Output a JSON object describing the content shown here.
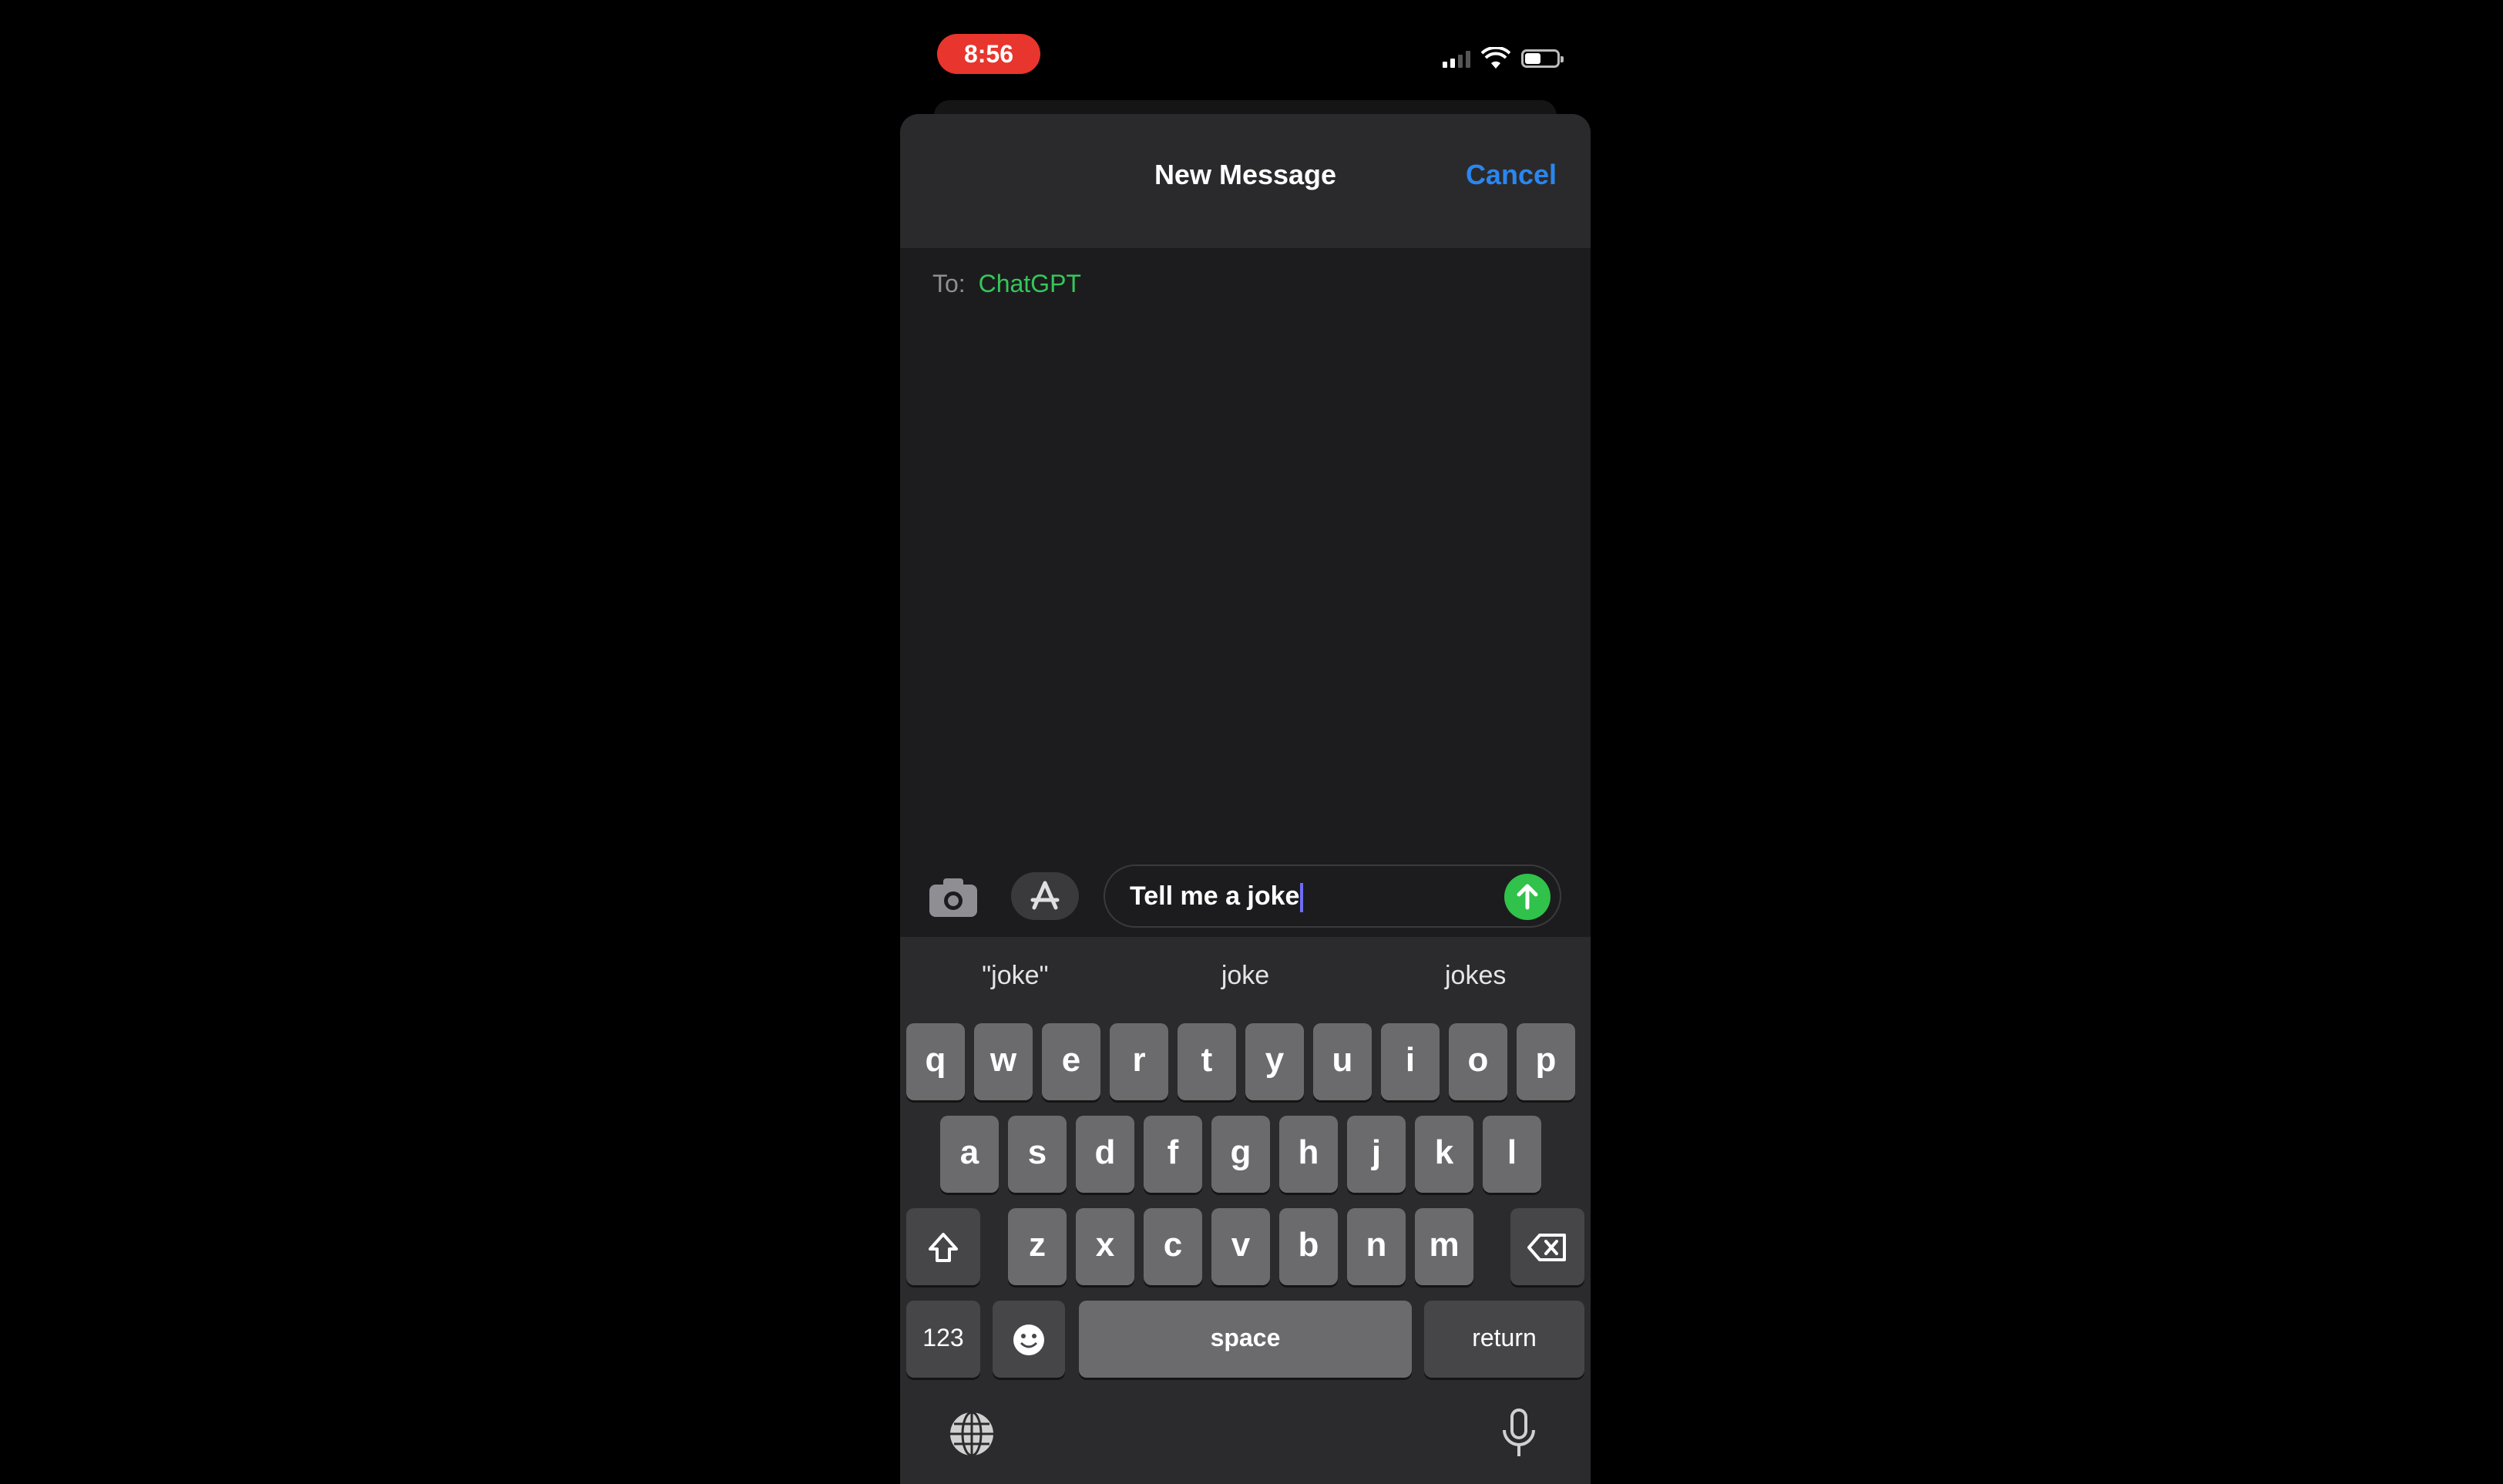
{
  "status_bar": {
    "time": "8:56",
    "time_pill_color": "#e8352d",
    "icons": [
      "signal-icon",
      "wifi-icon",
      "battery-icon"
    ],
    "battery_level": 0.5
  },
  "header": {
    "title": "New Message",
    "cancel_label": "Cancel",
    "accent_color": "#2a86f0"
  },
  "recipient": {
    "label": "To:",
    "name": "ChatGPT",
    "name_color": "#34c759"
  },
  "composer": {
    "text": "Tell me a joke",
    "camera_icon": "camera-icon",
    "apps_icon": "app-store-icon",
    "send_icon": "send-arrow-icon",
    "send_color": "#30c24a"
  },
  "keyboard": {
    "predictions": [
      "\"joke\"",
      "joke",
      "jokes"
    ],
    "row1": [
      "q",
      "w",
      "e",
      "r",
      "t",
      "y",
      "u",
      "i",
      "o",
      "p"
    ],
    "row2": [
      "a",
      "s",
      "d",
      "f",
      "g",
      "h",
      "j",
      "k",
      "l"
    ],
    "row3": [
      "z",
      "x",
      "c",
      "v",
      "b",
      "n",
      "m"
    ],
    "shift_icon": "shift-icon",
    "delete_icon": "delete-icon",
    "numbers_label": "123",
    "emoji_icon": "emoji-icon",
    "space_label": "space",
    "return_label": "return",
    "globe_icon": "globe-icon",
    "mic_icon": "microphone-icon"
  }
}
